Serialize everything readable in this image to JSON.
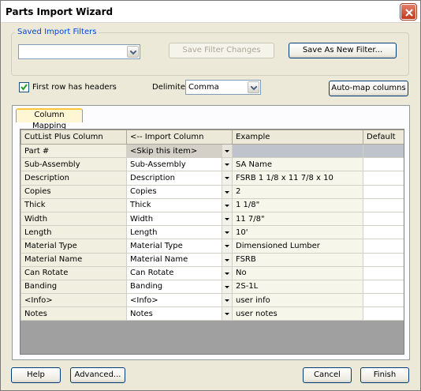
{
  "window": {
    "title": "Parts Import Wizard"
  },
  "filters": {
    "group_label": "Saved Import Filters",
    "selected_value": "",
    "save_changes_label": "Save Filter Changes",
    "save_new_label": "Save As New Filter..."
  },
  "options": {
    "first_row_headers_label": "First row has headers",
    "first_row_headers_checked": true,
    "delimiter_label": "Delimiter",
    "delimiter_value": "Comma",
    "auto_map_label": "Auto-map columns"
  },
  "tab": {
    "label": "Column Mapping"
  },
  "grid": {
    "headers": [
      "CutList Plus Column",
      "<-- Import Column",
      "Example",
      "Default"
    ],
    "rows": [
      {
        "column": "Part #",
        "import": "<Skip this item>",
        "example": "",
        "default": ""
      },
      {
        "column": "Sub-Assembly",
        "import": "Sub-Assembly",
        "example": "SA Name",
        "default": ""
      },
      {
        "column": "Description",
        "import": "Description",
        "example": "FSRB 1 1/8 x 11 7/8 x 10",
        "default": ""
      },
      {
        "column": "Copies",
        "import": "Copies",
        "example": "2",
        "default": ""
      },
      {
        "column": "Thick",
        "import": "Thick",
        "example": "1 1/8\"",
        "default": ""
      },
      {
        "column": "Width",
        "import": "Width",
        "example": "11 7/8\"",
        "default": ""
      },
      {
        "column": "Length",
        "import": "Length",
        "example": "10'",
        "default": ""
      },
      {
        "column": "Material Type",
        "import": "Material Type",
        "example": "Dimensioned Lumber",
        "default": ""
      },
      {
        "column": "Material Name",
        "import": "Material Name",
        "example": "FSRB",
        "default": ""
      },
      {
        "column": "Can Rotate",
        "import": "Can Rotate",
        "example": "No",
        "default": ""
      },
      {
        "column": "Banding",
        "import": "Banding",
        "example": "2S-1L",
        "default": ""
      },
      {
        "column": "<Info>",
        "import": "<Info>",
        "example": "user info",
        "default": ""
      },
      {
        "column": "Notes",
        "import": "Notes",
        "example": "user notes",
        "default": ""
      }
    ]
  },
  "footer": {
    "help_label": "Help",
    "advanced_label": "Advanced...",
    "cancel_label": "Cancel",
    "finish_label": "Finish"
  }
}
